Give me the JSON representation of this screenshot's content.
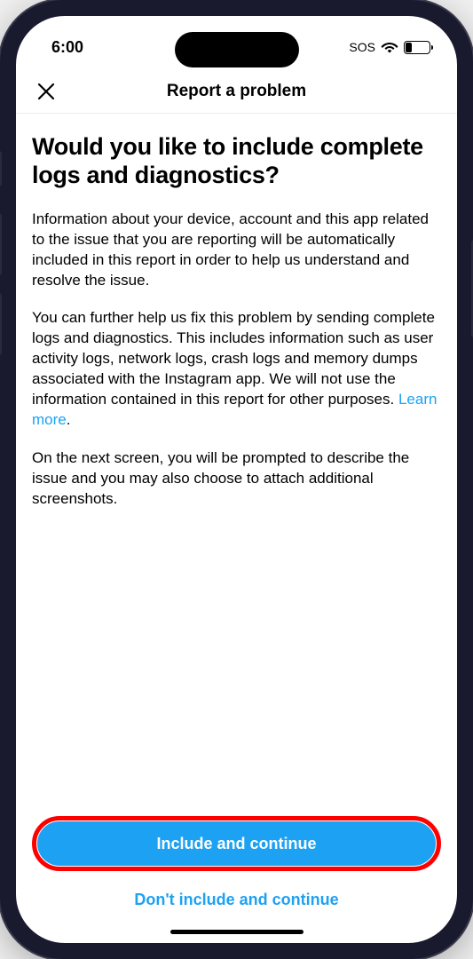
{
  "status": {
    "time": "6:00",
    "sos": "SOS",
    "battery_pct": "27"
  },
  "nav": {
    "title": "Report a problem"
  },
  "content": {
    "heading": "Would you like to include complete logs and diagnostics?",
    "para1": "Information about your device, account and this app related to the issue that you are reporting will be automatically included in this report in order to help us understand and resolve the issue.",
    "para2": "You can further help us fix this problem by sending complete logs and diagnostics. This includes information such as user activity logs, network logs, crash logs and memory dumps associated with the Instagram app. We will not use the information contained in this report for other purposes. ",
    "learn_more": "Learn more",
    "dot": ".",
    "para3": "On the next screen, you will be prompted to describe the issue and you may also choose to attach additional screenshots."
  },
  "buttons": {
    "primary": "Include and continue",
    "secondary": "Don't include and continue"
  }
}
